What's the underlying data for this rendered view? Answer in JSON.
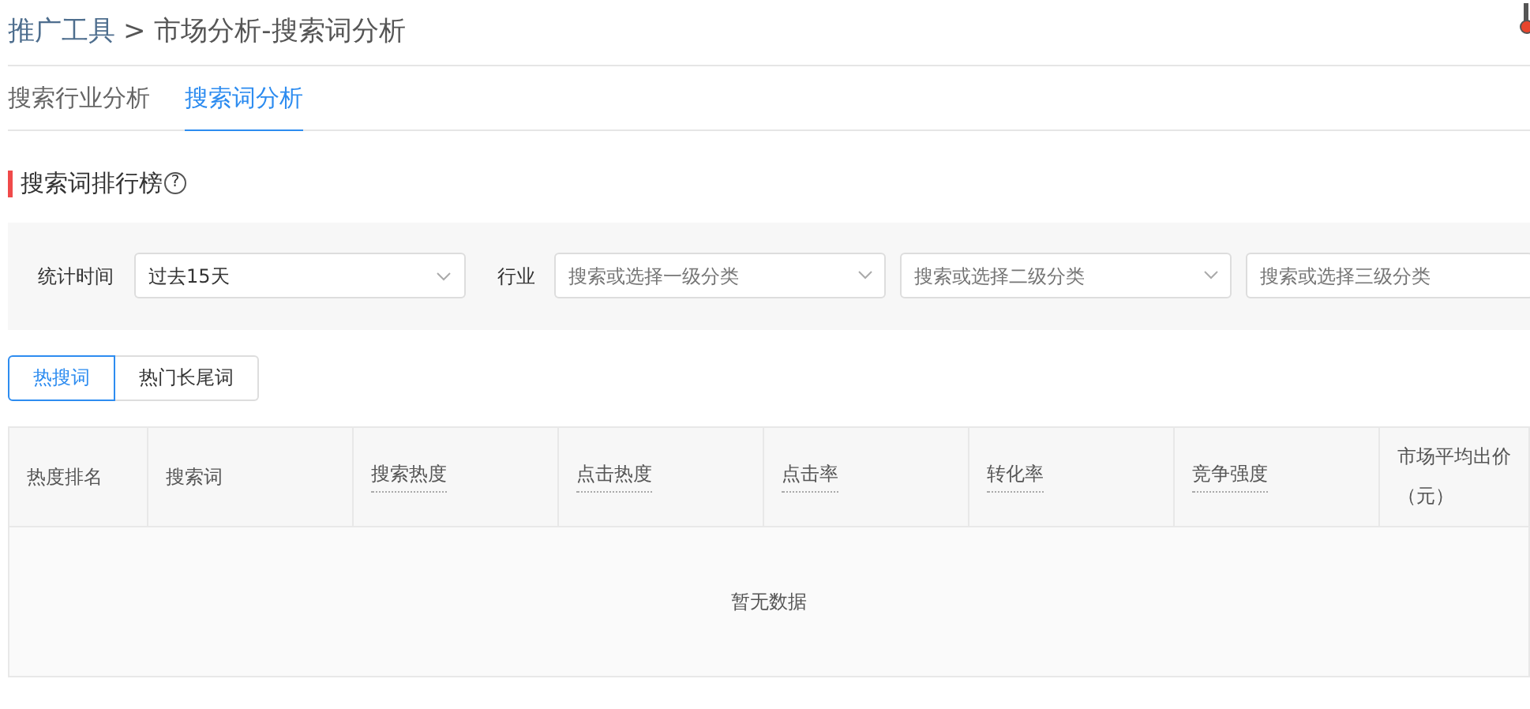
{
  "breadcrumb": {
    "parent": "推广工具",
    "separator": ">",
    "current": "市场分析-搜索词分析"
  },
  "tabs": [
    {
      "label": "搜索行业分析",
      "selected": false
    },
    {
      "label": "搜索词分析",
      "selected": true
    }
  ],
  "section": {
    "title": "搜索词排行榜",
    "help": "?"
  },
  "filters": {
    "time_label": "统计时间",
    "time_value": "过去15天",
    "industry_label": "行业",
    "industry_selects": [
      {
        "placeholder": "搜索或选择一级分类"
      },
      {
        "placeholder": "搜索或选择二级分类"
      },
      {
        "placeholder": "搜索或选择三级分类"
      }
    ]
  },
  "toggles": [
    {
      "label": "热搜词",
      "selected": true
    },
    {
      "label": "热门长尾词",
      "selected": false
    }
  ],
  "table": {
    "columns": [
      {
        "label": "热度排名",
        "dotted": false
      },
      {
        "label": "搜索词",
        "dotted": false
      },
      {
        "label": "搜索热度",
        "dotted": true
      },
      {
        "label": "点击热度",
        "dotted": true
      },
      {
        "label": "点击率",
        "dotted": true
      },
      {
        "label": "转化率",
        "dotted": true
      },
      {
        "label": "竞争强度",
        "dotted": true
      },
      {
        "label": "市场平均出价（元）",
        "dotted": false
      }
    ],
    "empty_text": "暂无数据"
  }
}
